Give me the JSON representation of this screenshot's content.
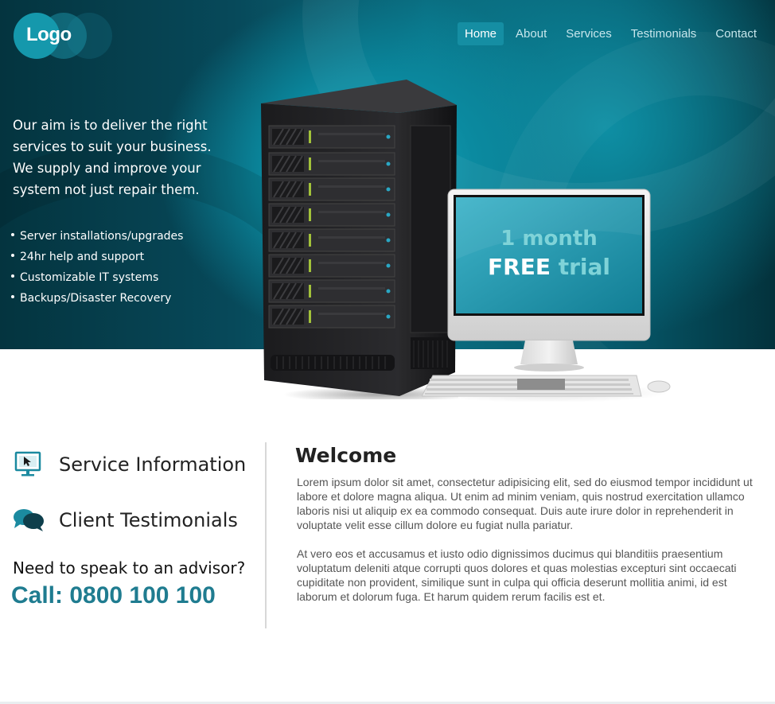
{
  "header": {
    "logo_text": "Logo",
    "nav": [
      {
        "label": "Home",
        "active": true
      },
      {
        "label": "About",
        "active": false
      },
      {
        "label": "Services",
        "active": false
      },
      {
        "label": "Testimonials",
        "active": false
      },
      {
        "label": "Contact",
        "active": false
      }
    ]
  },
  "hero": {
    "tagline": "Our aim is to deliver the right services to suit your business. We supply and improve your system not just repair them.",
    "features": [
      "Server installations/upgrades",
      "24hr help and support",
      "Customizable IT systems",
      "Backups/Disaster Recovery"
    ],
    "promo": {
      "line1": "1 month",
      "free": "FREE",
      "trial": "trial"
    }
  },
  "sidebar": {
    "items": [
      {
        "label": "Service Information",
        "icon": "monitor-cursor-icon"
      },
      {
        "label": "Client Testimonials",
        "icon": "speech-bubbles-icon"
      }
    ],
    "advisor_text": "Need to speak to an advisor?",
    "call_text": "Call: 0800 100 100"
  },
  "main": {
    "heading": "Welcome",
    "paragraphs": [
      "Lorem ipsum dolor sit amet, consectetur adipisicing elit, sed do eiusmod tempor incididunt ut labore et dolore magna aliqua. Ut enim ad minim veniam, quis nostrud exercitation ullamco laboris nisi ut aliquip ex ea commodo consequat. Duis aute irure dolor in reprehenderit in voluptate velit esse cillum dolore eu fugiat nulla pariatur.",
      "At vero eos et accusamus et iusto odio dignissimos ducimus qui blanditiis praesentium voluptatum deleniti atque corrupti quos dolores et quas molestias excepturi sint occaecati cupiditate non provident, similique sunt in culpa qui officia deserunt mollitia animi, id est laborum et dolorum fuga. Et harum quidem rerum facilis est et."
    ]
  },
  "colors": {
    "accent": "#1f7c90",
    "nav_active_bg": "#158ea3",
    "hero_dark": "#04343f",
    "promo_highlight": "#7fd3d8"
  }
}
